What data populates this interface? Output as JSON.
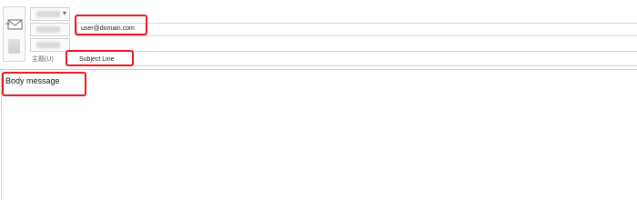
{
  "header": {
    "to_value": "user@domain.com",
    "subject_label": "主题(U)",
    "subject_value": "Subject Line"
  },
  "body": {
    "message": "Body message"
  },
  "icons": {
    "send": "send-icon",
    "dropdown": "chevron-down-icon"
  },
  "colors": {
    "highlight": "#e8141c",
    "border": "#cfcfcf",
    "label": "#666666"
  }
}
